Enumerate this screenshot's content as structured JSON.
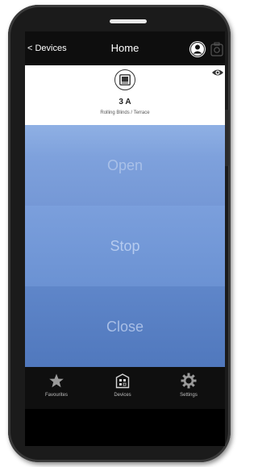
{
  "header": {
    "back_label": "< Devices",
    "title": "Home",
    "user_icon": "user-icon",
    "camera_icon": "camera-icon"
  },
  "device": {
    "name": "3 A",
    "location": "Rolling Blinds / Terrace",
    "icon": "blinds-icon",
    "visibility_icon": "eye-icon"
  },
  "controls": {
    "open_label": "Open",
    "stop_label": "Stop",
    "close_label": "Close"
  },
  "tabs": [
    {
      "label": "Favourites",
      "icon": "star-icon"
    },
    {
      "label": "Devices",
      "icon": "devices-icon"
    },
    {
      "label": "Settings",
      "icon": "gear-icon"
    }
  ],
  "colors": {
    "accent_blue": "#7598d6",
    "bar_dark": "#0f0f0f"
  }
}
